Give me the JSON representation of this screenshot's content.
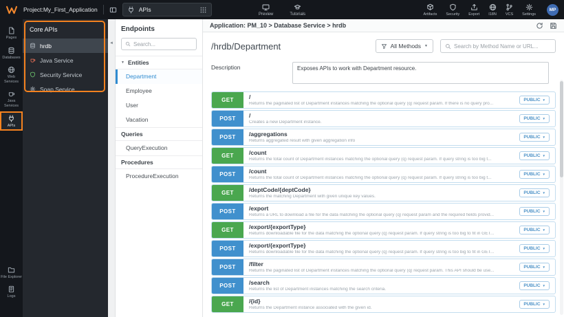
{
  "topbar": {
    "project_label": "Project:My_First_Application",
    "selector_value": "APIs",
    "preview_label": "Preview",
    "tutorials_label": "Tutorials",
    "right_items": [
      "Artifacts",
      "Security",
      "Export",
      "I18N",
      "VCS",
      "Settings"
    ],
    "avatar_initials": "MP"
  },
  "left_nav": {
    "items": [
      "Pages",
      "Databases",
      "Web Services",
      "Java Services",
      "APIs"
    ],
    "bottom_items": [
      "File Explorer",
      "Logs"
    ],
    "active_item": "APIs"
  },
  "core_apis": {
    "title": "Core APIs",
    "items": [
      {
        "label": "hrdb",
        "selected": true
      },
      {
        "label": "Java Service",
        "selected": false
      },
      {
        "label": "Security Service",
        "selected": false
      },
      {
        "label": "Soap Service",
        "selected": false
      }
    ]
  },
  "endpoints": {
    "title": "Endpoints",
    "search_placeholder": "Search...",
    "sections": [
      {
        "label": "Entities",
        "items": [
          "Department",
          "Employee",
          "User",
          "Vacation"
        ],
        "selected_item": "Department"
      },
      {
        "label": "Queries",
        "items": [
          "QueryExecution"
        ]
      },
      {
        "label": "Procedures",
        "items": [
          "ProcedureExecution"
        ]
      }
    ]
  },
  "main": {
    "breadcrumb": "Application: PM_10 > Database Service > hrdb",
    "title": "/hrdb/Department",
    "filter_label": "All Methods",
    "search_placeholder": "Search by Method Name or URL...",
    "description_label": "Description",
    "description_value": "Exposes APIs to work with Department resource.",
    "access_label": "PUBLIC",
    "rows": [
      {
        "method": "GET",
        "path": "/",
        "desc": "Returns the paginated list of Department instances matching the optional query (q) request param. If there is no query pro..."
      },
      {
        "method": "POST",
        "path": "/",
        "desc": "Creates a new Department instance."
      },
      {
        "method": "POST",
        "path": "/aggregations",
        "desc": "Returns aggregated result with given aggregation info"
      },
      {
        "method": "GET",
        "path": "/count",
        "desc": "Returns the total count of Department instances matching the optional query (q) request param. If query string is too big t..."
      },
      {
        "method": "POST",
        "path": "/count",
        "desc": "Returns the total count of Department instances matching the optional query (q) request param. If query string is too big t..."
      },
      {
        "method": "GET",
        "path": "/deptCode/{deptCode}",
        "desc": "Returns the matching Department with given unique key values."
      },
      {
        "method": "POST",
        "path": "/export",
        "desc": "Returns a URL to download a file for the data matching the optional query (q) request param and the required fields provid..."
      },
      {
        "method": "GET",
        "path": "/export/{exportType}",
        "desc": "Returns downloadable file for the data matching the optional query (q) request param. If query string is too big to fit in GET..."
      },
      {
        "method": "POST",
        "path": "/export/{exportType}",
        "desc": "Returns downloadable file for the data matching the optional query (q) request param. If query string is too big to fit in GET..."
      },
      {
        "method": "POST",
        "path": "/filter",
        "desc": "Returns the paginated list of Department instances matching the optional query (q) request param. This API should be use..."
      },
      {
        "method": "POST",
        "path": "/search",
        "desc": "Returns the list of Department instances matching the search criteria."
      },
      {
        "method": "GET",
        "path": "/{id}",
        "desc": "Returns the Department instance associated with the given id."
      }
    ]
  },
  "colors": {
    "get_badge": "#4aa74f",
    "post_badge": "#4090cd",
    "annotation_orange": "#f5821f",
    "selected_blue": "#2f8bd0",
    "public_badge": "#4a90c6"
  }
}
